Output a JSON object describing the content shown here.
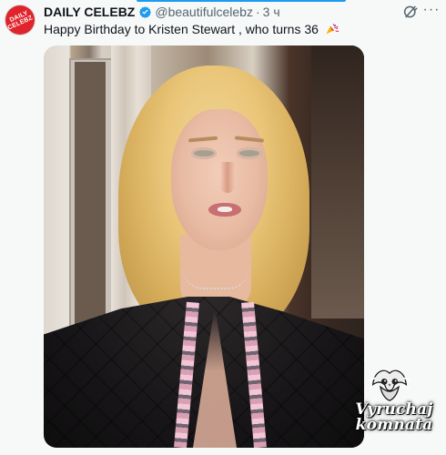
{
  "post": {
    "avatar_text_1": "DAILY",
    "avatar_text_2": "CELEBZ",
    "display_name": "DAILY CELEBZ",
    "handle": "@beautifulcelebz",
    "separator": "·",
    "time": "3 ч",
    "text": "Happy Birthday to Kristen Stewart , who turns 36",
    "emoji_icon": "party-popper-icon",
    "verified_icon": "verified-badge-icon",
    "grok_icon": "grok-icon",
    "more_icon": "more-options-icon",
    "more_label": "···"
  },
  "watermark": {
    "line1": "Vyruchaj",
    "line2": "komnata",
    "owl_icon": "owl-icon"
  },
  "colors": {
    "accent": "#1d9bf0",
    "avatar": "#e0242b",
    "secondary_text": "#536471",
    "primary_text": "#0f1419"
  }
}
